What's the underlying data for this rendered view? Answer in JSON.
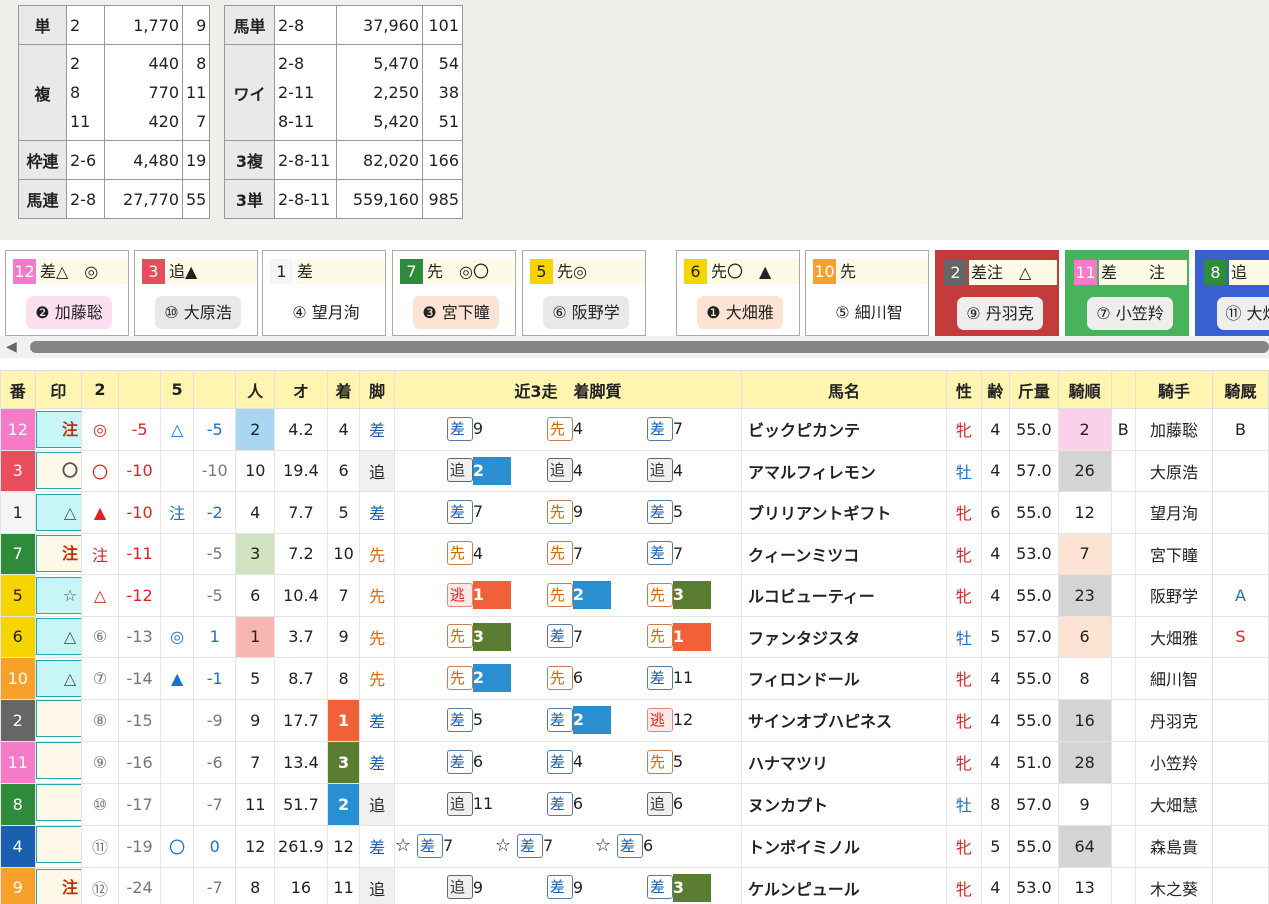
{
  "payouts": {
    "left": [
      {
        "type": "単",
        "rows": [
          [
            "2",
            "1,770",
            "9"
          ]
        ]
      },
      {
        "type": "複",
        "rows": [
          [
            "2",
            "440",
            "8"
          ],
          [
            "8",
            "770",
            "11"
          ],
          [
            "11",
            "420",
            "7"
          ]
        ]
      },
      {
        "type": "枠連",
        "rows": [
          [
            "2-6",
            "4,480",
            "19"
          ]
        ]
      },
      {
        "type": "馬連",
        "rows": [
          [
            "2-8",
            "27,770",
            "55"
          ]
        ]
      }
    ],
    "right": [
      {
        "type": "馬単",
        "rows": [
          [
            "2-8",
            "37,960",
            "101"
          ]
        ]
      },
      {
        "type": "ワイ",
        "rows": [
          [
            "2-8",
            "5,470",
            "54"
          ],
          [
            "2-11",
            "2,250",
            "38"
          ],
          [
            "8-11",
            "5,420",
            "51"
          ]
        ]
      },
      {
        "type": "3複",
        "rows": [
          [
            "2-8-11",
            "82,020",
            "166"
          ]
        ]
      },
      {
        "type": "3単",
        "rows": [
          [
            "2-8-11",
            "559,160",
            "985"
          ]
        ]
      }
    ]
  },
  "cards": [
    {
      "num": "12",
      "style": "差△　◎",
      "jockey": "❷ 加藤聡",
      "color": "#f57ac8",
      "bg": "#fff",
      "jbg": "#fde0f0"
    },
    {
      "num": "3",
      "style": "追▲",
      "jockey": "⑩ 大原浩",
      "color": "#e94c5a",
      "bg": "#fff",
      "jbg": "#e8e8e8"
    },
    {
      "num": "1",
      "style": "差",
      "jockey": "④ 望月洵",
      "color": "#f5f5f5",
      "tc": "#222",
      "bg": "#fff",
      "jbg": "#fff"
    },
    {
      "num": "7",
      "style": "先　◎〇",
      "jockey": "❸ 宮下瞳",
      "color": "#2e8b3a",
      "bg": "#fff",
      "jbg": "#fde3d3"
    },
    {
      "num": "5",
      "style": "先◎",
      "jockey": "⑥ 阪野学",
      "color": "#f5d400",
      "tc": "#222",
      "bg": "#fff",
      "jbg": "#e8e8e8"
    },
    {
      "num": "6",
      "style": "先〇　▲",
      "jockey": "❶ 大畑雅",
      "color": "#f5d400",
      "tc": "#222",
      "bg": "#fff",
      "jbg": "#fde3d3"
    },
    {
      "num": "10",
      "style": "先",
      "jockey": "⑤ 細川智",
      "color": "#f7a12a",
      "bg": "#fff",
      "jbg": "#fff"
    },
    {
      "num": "2",
      "style": "差注　△",
      "jockey": "⑨ 丹羽克",
      "color": "#666",
      "bg": "#c43b3b",
      "jbg": "#eee",
      "dark": true
    },
    {
      "num": "11",
      "style": "差　　注",
      "jockey": "⑦ 小笠羚",
      "color": "#f57ac8",
      "bg": "#48b35a",
      "jbg": "#eee",
      "dark": true
    },
    {
      "num": "8",
      "style": "追",
      "jockey": "⑪ 大畑慧",
      "color": "#2e8b3a",
      "bg": "#3a5fd0",
      "jbg": "#eee",
      "dark": true
    }
  ],
  "table": {
    "headers": [
      "番",
      "印",
      "2",
      "",
      "5",
      "",
      "人",
      "オ",
      "着",
      "脚",
      "近3走　着脚質",
      "馬名",
      "性",
      "齢",
      "斤量",
      "騎順",
      "",
      "騎手",
      "騎厩"
    ],
    "rows": [
      {
        "n": "12",
        "nc": "#f57ac8",
        "mark": "注",
        "mc": true,
        "m2": "◎",
        "m2c": "red",
        "d2": "-5",
        "d2c": "red",
        "m5": "△",
        "m5c": "blue",
        "d5": "-5",
        "d5c": "blue",
        "pop": "2",
        "popbg": "#a9d6f0",
        "odds": "4.2",
        "fin": "4",
        "finbg": "",
        "leg": "差",
        "legc": "ash-sa",
        "r": [
          [
            "",
            "差",
            "9",
            ""
          ],
          [
            "",
            "先",
            "4",
            ""
          ],
          [
            "",
            "差",
            "7",
            ""
          ]
        ],
        "name": "ビックピカンテ",
        "sex": "牝",
        "sc": "sexm",
        "age": "4",
        "wt": "55.0",
        "jr": "2",
        "jrbg": "#fbd0ea",
        "b": "B",
        "jockey": "加藤聡",
        "stab": "B",
        "stc": ""
      },
      {
        "n": "3",
        "nc": "#e94c5a",
        "mark": "〇",
        "mc": false,
        "m2": "〇",
        "m2c": "red",
        "d2": "-10",
        "d2c": "red",
        "m5": "",
        "m5c": "",
        "d5": "-10",
        "d5c": "gray",
        "pop": "10",
        "popbg": "",
        "odds": "19.4",
        "fin": "6",
        "finbg": "",
        "leg": "追",
        "legc": "",
        "r": [
          [
            "",
            "追",
            "2",
            "#2a8fd0"
          ],
          [
            "",
            "追",
            "4",
            ""
          ],
          [
            "",
            "追",
            "4",
            ""
          ]
        ],
        "name": "アマルフィレモン",
        "sex": "牡",
        "sc": "sexf",
        "age": "4",
        "wt": "57.0",
        "jr": "26",
        "jrbg": "#d4d4d4",
        "b": "",
        "jockey": "大原浩",
        "stab": "",
        "stc": ""
      },
      {
        "n": "1",
        "nc": "#f5f5f5",
        "ntc": "#222",
        "mark": "△",
        "mc": true,
        "m2": "▲",
        "m2c": "red",
        "d2": "-10",
        "d2c": "red",
        "m5": "注",
        "m5c": "blue",
        "d5": "-2",
        "d5c": "blue",
        "pop": "4",
        "popbg": "",
        "odds": "7.7",
        "fin": "5",
        "finbg": "",
        "leg": "差",
        "legc": "ash-sa",
        "r": [
          [
            "",
            "差",
            "7",
            ""
          ],
          [
            "",
            "先",
            "9",
            ""
          ],
          [
            "",
            "差",
            "5",
            ""
          ]
        ],
        "name": "ブリリアントギフト",
        "sex": "牝",
        "sc": "sexm",
        "age": "6",
        "wt": "55.0",
        "jr": "12",
        "jrbg": "",
        "b": "",
        "jockey": "望月洵",
        "stab": "",
        "stc": ""
      },
      {
        "n": "7",
        "nc": "#2e8b3a",
        "mark": "注",
        "mc": false,
        "m2": "注",
        "m2c": "red",
        "d2": "-11",
        "d2c": "red",
        "m5": "",
        "m5c": "",
        "d5": "-5",
        "d5c": "gray",
        "pop": "3",
        "popbg": "#cfe3c0",
        "odds": "7.2",
        "fin": "10",
        "finbg": "",
        "leg": "先",
        "legc": "ash-se",
        "r": [
          [
            "",
            "先",
            "4",
            ""
          ],
          [
            "",
            "先",
            "7",
            ""
          ],
          [
            "",
            "差",
            "7",
            ""
          ]
        ],
        "name": "クィーンミツコ",
        "sex": "牝",
        "sc": "sexm",
        "age": "4",
        "wt": "53.0",
        "jr": "7",
        "jrbg": "#fde3d3",
        "b": "",
        "jockey": "宮下瞳",
        "stab": "",
        "stc": ""
      },
      {
        "n": "5",
        "nc": "#f5d400",
        "ntc": "#222",
        "mark": "☆",
        "mc": true,
        "m2": "△",
        "m2c": "red",
        "d2": "-12",
        "d2c": "red",
        "m5": "",
        "m5c": "",
        "d5": "-5",
        "d5c": "gray",
        "pop": "6",
        "popbg": "",
        "odds": "10.4",
        "fin": "7",
        "finbg": "",
        "leg": "先",
        "legc": "ash-se",
        "r": [
          [
            "",
            "逃",
            "1",
            "#f0613a"
          ],
          [
            "",
            "先",
            "2",
            "#2a8fd0"
          ],
          [
            "",
            "先",
            "3",
            "#5a7d32"
          ]
        ],
        "name": "ルコビューティー",
        "sex": "牝",
        "sc": "sexm",
        "age": "4",
        "wt": "55.0",
        "jr": "23",
        "jrbg": "#d4d4d4",
        "b": "",
        "jockey": "阪野学",
        "stab": "A",
        "stc": "blue"
      },
      {
        "n": "6",
        "nc": "#f5d400",
        "ntc": "#222",
        "mark": "△",
        "mc": true,
        "m2": "⑥",
        "m2c": "gray",
        "d2": "-13",
        "d2c": "gray",
        "m5": "◎",
        "m5c": "blue",
        "d5": "1",
        "d5c": "blue",
        "pop": "1",
        "popbg": "#f8b6b0",
        "odds": "3.7",
        "fin": "9",
        "finbg": "",
        "leg": "先",
        "legc": "ash-se",
        "r": [
          [
            "",
            "先",
            "3",
            "#5a7d32"
          ],
          [
            "",
            "差",
            "7",
            ""
          ],
          [
            "",
            "先",
            "1",
            "#f0613a"
          ]
        ],
        "name": "ファンタジスタ",
        "sex": "牡",
        "sc": "sexf",
        "age": "5",
        "wt": "57.0",
        "jr": "6",
        "jrbg": "#fde3d3",
        "b": "",
        "jockey": "大畑雅",
        "stab": "S",
        "stc": "red"
      },
      {
        "n": "10",
        "nc": "#f7a12a",
        "mark": "△",
        "mc": true,
        "m2": "⑦",
        "m2c": "gray",
        "d2": "-14",
        "d2c": "gray",
        "m5": "▲",
        "m5c": "blue",
        "d5": "-1",
        "d5c": "blue",
        "pop": "5",
        "popbg": "",
        "odds": "8.7",
        "fin": "8",
        "finbg": "",
        "leg": "先",
        "legc": "ash-se",
        "r": [
          [
            "",
            "先",
            "2",
            "#2a8fd0"
          ],
          [
            "",
            "先",
            "6",
            ""
          ],
          [
            "",
            "差",
            "11",
            ""
          ]
        ],
        "name": "フィロンドール",
        "sex": "牝",
        "sc": "sexm",
        "age": "4",
        "wt": "55.0",
        "jr": "8",
        "jrbg": "",
        "b": "",
        "jockey": "細川智",
        "stab": "",
        "stc": ""
      },
      {
        "n": "2",
        "nc": "#666",
        "mark": "",
        "mc": false,
        "m2": "⑧",
        "m2c": "gray",
        "d2": "-15",
        "d2c": "gray",
        "m5": "",
        "m5c": "",
        "d5": "-9",
        "d5c": "gray",
        "pop": "9",
        "popbg": "",
        "odds": "17.7",
        "fin": "1",
        "finbg": "#f0613a",
        "leg": "差",
        "legc": "ash-sa",
        "r": [
          [
            "",
            "差",
            "5",
            ""
          ],
          [
            "",
            "差",
            "2",
            "#2a8fd0"
          ],
          [
            "",
            "逃",
            "12",
            ""
          ]
        ],
        "name": "サインオブハピネス",
        "sex": "牝",
        "sc": "sexm",
        "age": "4",
        "wt": "55.0",
        "jr": "16",
        "jrbg": "#d4d4d4",
        "b": "",
        "jockey": "丹羽克",
        "stab": "",
        "stc": ""
      },
      {
        "n": "11",
        "nc": "#f57ac8",
        "mark": "",
        "mc": false,
        "m2": "⑨",
        "m2c": "gray",
        "d2": "-16",
        "d2c": "gray",
        "m5": "",
        "m5c": "",
        "d5": "-6",
        "d5c": "gray",
        "pop": "7",
        "popbg": "",
        "odds": "13.4",
        "fin": "3",
        "finbg": "#5a7d32",
        "leg": "差",
        "legc": "ash-sa",
        "r": [
          [
            "",
            "差",
            "6",
            ""
          ],
          [
            "",
            "差",
            "4",
            ""
          ],
          [
            "",
            "先",
            "5",
            ""
          ]
        ],
        "name": "ハナマツリ",
        "sex": "牝",
        "sc": "sexm",
        "age": "4",
        "wt": "51.0",
        "jr": "28",
        "jrbg": "#d4d4d4",
        "b": "",
        "jockey": "小笠羚",
        "stab": "",
        "stc": ""
      },
      {
        "n": "8",
        "nc": "#2e8b3a",
        "mark": "",
        "mc": false,
        "m2": "⑩",
        "m2c": "gray",
        "d2": "-17",
        "d2c": "gray",
        "m5": "",
        "m5c": "",
        "d5": "-7",
        "d5c": "gray",
        "pop": "11",
        "popbg": "",
        "odds": "51.7",
        "fin": "2",
        "finbg": "#2a8fd0",
        "leg": "追",
        "legc": "",
        "r": [
          [
            "",
            "追",
            "11",
            ""
          ],
          [
            "",
            "差",
            "6",
            ""
          ],
          [
            "",
            "追",
            "6",
            ""
          ]
        ],
        "name": "ヌンカプト",
        "sex": "牡",
        "sc": "sexf",
        "age": "8",
        "wt": "57.0",
        "jr": "9",
        "jrbg": "",
        "b": "",
        "jockey": "大畑慧",
        "stab": "",
        "stc": ""
      },
      {
        "n": "4",
        "nc": "#1a5fb0",
        "mark": "",
        "mc": false,
        "m2": "⑪",
        "m2c": "gray",
        "d2": "-19",
        "d2c": "gray",
        "m5": "〇",
        "m5c": "blue",
        "d5": "0",
        "d5c": "blue",
        "pop": "12",
        "popbg": "",
        "odds": "261.9",
        "fin": "12",
        "finbg": "",
        "leg": "差",
        "legc": "ash-sa",
        "r": [
          [
            "☆",
            "差",
            "7",
            ""
          ],
          [
            "☆",
            "差",
            "7",
            ""
          ],
          [
            "☆",
            "差",
            "6",
            ""
          ]
        ],
        "name": "トンボイミノル",
        "sex": "牝",
        "sc": "sexm",
        "age": "5",
        "wt": "55.0",
        "jr": "64",
        "jrbg": "#d4d4d4",
        "b": "",
        "jockey": "森島貴",
        "stab": "",
        "stc": ""
      },
      {
        "n": "9",
        "nc": "#f7a12a",
        "mark": "注",
        "mc": false,
        "m2": "⑫",
        "m2c": "gray",
        "d2": "-24",
        "d2c": "gray",
        "m5": "",
        "m5c": "",
        "d5": "-7",
        "d5c": "gray",
        "pop": "8",
        "popbg": "",
        "odds": "16",
        "fin": "11",
        "finbg": "",
        "leg": "追",
        "legc": "",
        "r": [
          [
            "",
            "追",
            "9",
            ""
          ],
          [
            "",
            "差",
            "9",
            ""
          ],
          [
            "",
            "差",
            "3",
            "#5a7d32"
          ]
        ],
        "name": "ケルンピュール",
        "sex": "牝",
        "sc": "sexm",
        "age": "4",
        "wt": "53.0",
        "jr": "13",
        "jrbg": "",
        "b": "",
        "jockey": "木之葵",
        "stab": "",
        "stc": ""
      }
    ]
  }
}
